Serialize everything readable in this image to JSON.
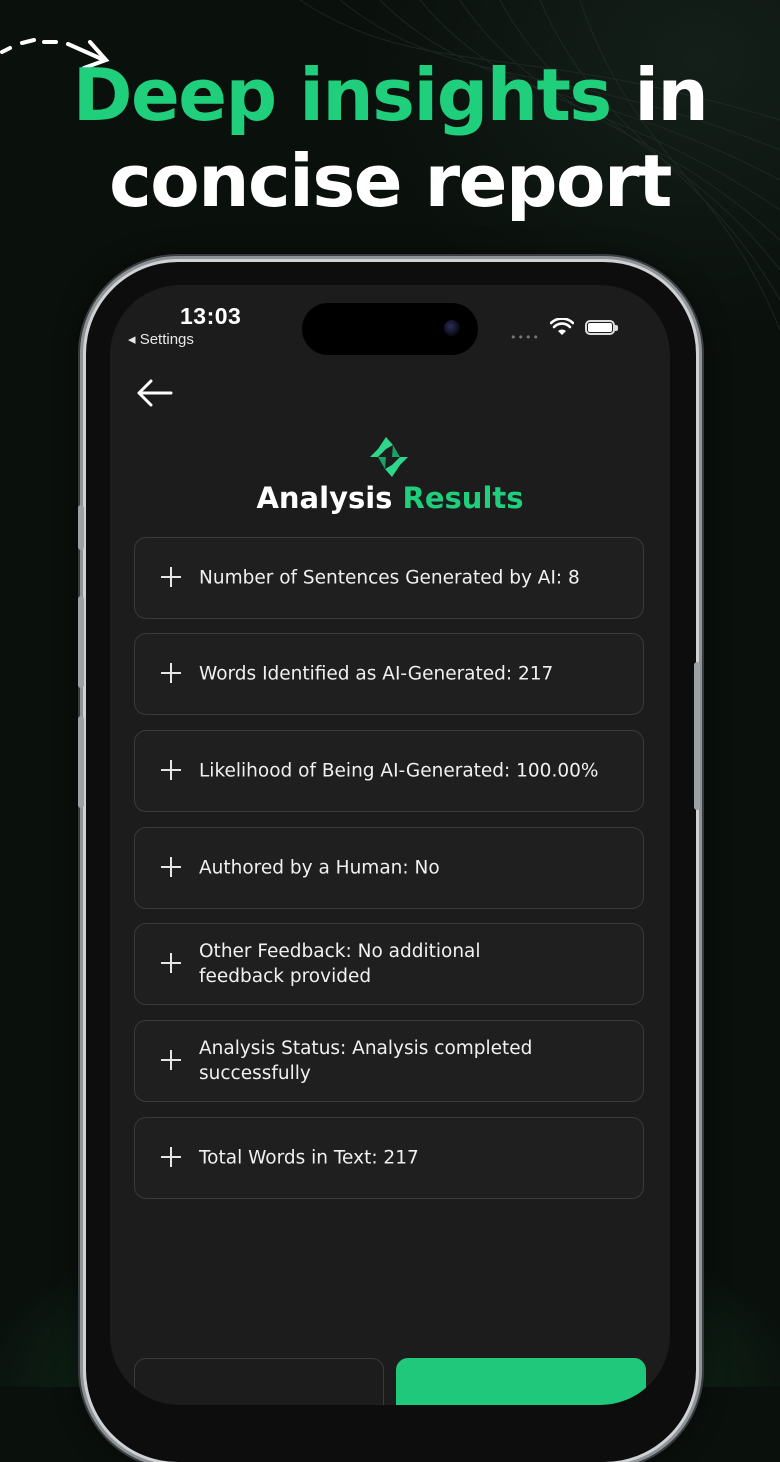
{
  "headline": {
    "accent": "Deep insights",
    "rest_line1": " in",
    "line2": "concise report"
  },
  "status_bar": {
    "time": "13:03",
    "back_label": "◂ Settings",
    "signal": "••••"
  },
  "screen": {
    "back_icon": "arrow-left-icon",
    "logo_icon": "sparkle-logo-icon",
    "title_plain": "Analysis",
    "title_accent": "Results",
    "items": [
      {
        "label": "Number of Sentences Generated by AI: 8"
      },
      {
        "label": "Words Identified as AI-Generated: 217"
      },
      {
        "label": "Likelihood of Being AI-Generated: 100.00%"
      },
      {
        "label": "Authored by a Human: No"
      },
      {
        "label": "Other Feedback: No additional feedback provided"
      },
      {
        "label": "Analysis Status: Analysis completed successfully"
      },
      {
        "label": "Total Words in Text: 217"
      }
    ]
  },
  "colors": {
    "accent": "#1fcf7b",
    "background": "#0a100c",
    "screen": "#1c1c1c"
  }
}
